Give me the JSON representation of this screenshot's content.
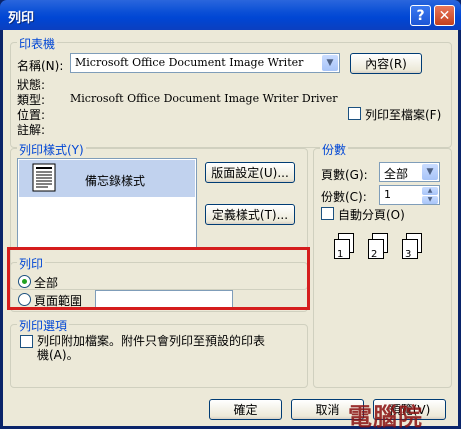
{
  "window": {
    "title": "列印",
    "help_label": "?",
    "close_label": "✕"
  },
  "printer": {
    "group_label": "印表機",
    "name_label": "名稱(N):",
    "name_value": "Microsoft Office Document Image Writer",
    "properties_button": "內容(R)",
    "status_label": "狀態:",
    "type_label": "類型:",
    "type_value": "Microsoft Office Document Image Writer Driver",
    "location_label": "位置:",
    "comment_label": "註解:",
    "print_to_file_label": "列印至檔案(F)"
  },
  "style": {
    "group_label": "列印樣式(Y)",
    "selected_item": "備忘錄樣式",
    "page_setup_button": "版面設定(U)...",
    "define_styles_button": "定義樣式(T)..."
  },
  "copies": {
    "group_label": "份數",
    "pages_label": "頁數(G):",
    "pages_value": "全部",
    "count_label": "份數(C):",
    "count_value": "1",
    "collate_label": "自動分頁(O)",
    "page_numbers": [
      "1",
      "1",
      "2",
      "2",
      "3",
      "3"
    ]
  },
  "range": {
    "group_label": "列印",
    "all_label": "全部",
    "pages_label": "頁面範圍",
    "pages_value": ""
  },
  "options": {
    "group_label": "列印選項",
    "attachments_label_line1": "列印附加檔案。附件只會列印至預設的印表",
    "attachments_label_line2": "機(A)。"
  },
  "footer": {
    "ok": "確定",
    "cancel": "取消",
    "preview": "預覽(V)"
  },
  "watermark": "電腦院",
  "colors": {
    "titlebar": "#0046d4",
    "group_label": "#0046d5",
    "highlight": "#d51d1d"
  }
}
